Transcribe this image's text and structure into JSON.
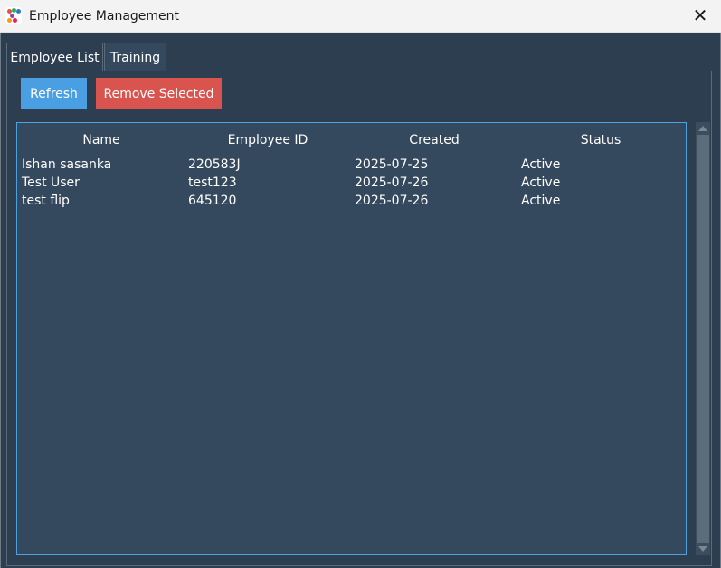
{
  "window": {
    "title": "Employee Management",
    "close_glyph": "✕",
    "icon": "app-dots-icon"
  },
  "tabs": [
    {
      "label": "Employee List",
      "active": true
    },
    {
      "label": "Training",
      "active": false
    }
  ],
  "toolbar": {
    "refresh_label": "Refresh",
    "remove_label": "Remove Selected"
  },
  "table": {
    "columns": [
      "Name",
      "Employee ID",
      "Created",
      "Status"
    ],
    "rows": [
      {
        "name": "Ishan sasanka",
        "employee_id": "220583J",
        "created": "2025-07-25",
        "status": "Active"
      },
      {
        "name": "Test User",
        "employee_id": "test123",
        "created": "2025-07-26",
        "status": "Active"
      },
      {
        "name": "test flip",
        "employee_id": "645120",
        "created": "2025-07-26",
        "status": "Active"
      }
    ]
  },
  "colors": {
    "background": "#2c3e50",
    "panel": "#34495e",
    "refresh_button": "#4a9fe3",
    "remove_button": "#d9534f",
    "tree_border": "#4aa3df"
  }
}
